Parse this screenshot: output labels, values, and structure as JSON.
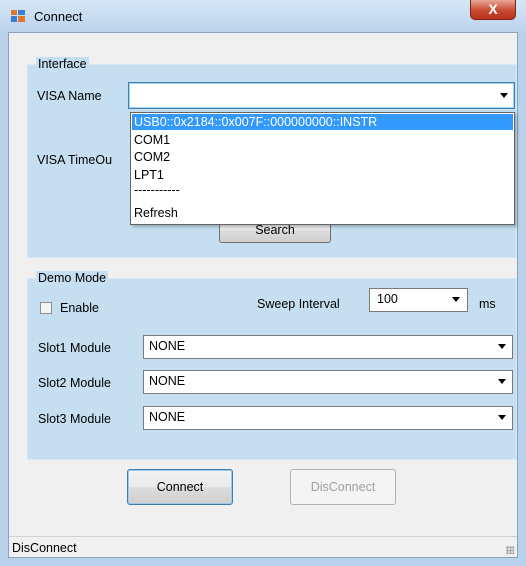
{
  "window": {
    "title": "Connect",
    "close_glyph": "X"
  },
  "interface": {
    "caption": "Interface",
    "visa_name_label": "VISA Name",
    "visa_name_value": "",
    "visa_timeout_label": "VISA TimeOu",
    "search_button": "Search",
    "dropdown_options": [
      "USB0::0x2184::0x007F::000000000::INSTR",
      "COM1",
      "COM2",
      "LPT1",
      "-----------",
      "Refresh"
    ]
  },
  "demo_mode": {
    "caption": "Demo Mode",
    "enable_label": "Enable",
    "enable_checked": false,
    "sweep_interval_label": "Sweep Interval",
    "sweep_interval_value": "100",
    "sweep_unit": "ms",
    "slot1_label": "Slot1 Module",
    "slot1_value": "NONE",
    "slot2_label": "Slot2 Module",
    "slot2_value": "NONE",
    "slot3_label": "Slot3 Module",
    "slot3_value": "NONE"
  },
  "buttons": {
    "connect": "Connect",
    "disconnect": "DisConnect"
  },
  "status": {
    "text": "DisConnect"
  }
}
